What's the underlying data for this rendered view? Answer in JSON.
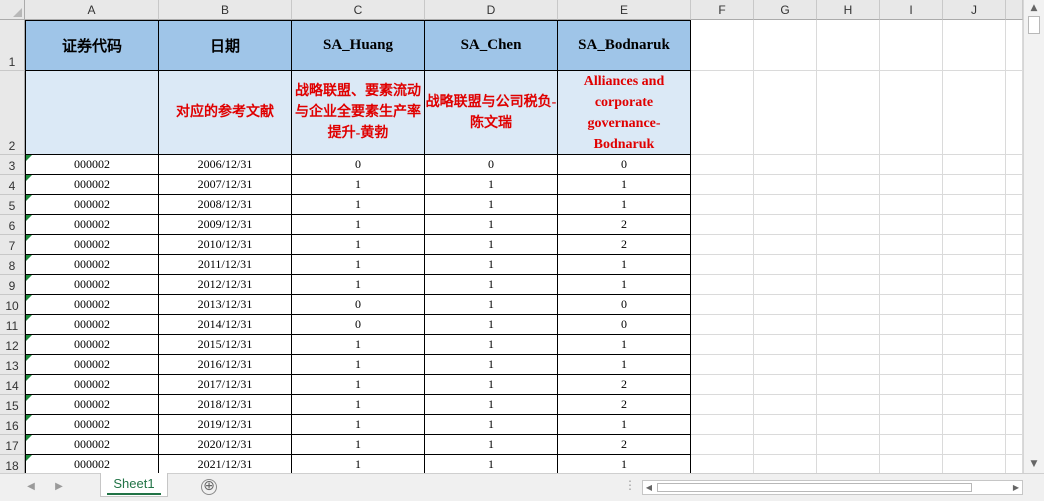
{
  "columns": [
    "A",
    "B",
    "C",
    "D",
    "E",
    "F",
    "G",
    "H",
    "I",
    "J"
  ],
  "header_row": [
    "证券代码",
    "日期",
    "SA_Huang",
    "SA_Chen",
    "SA_Bodnaruk"
  ],
  "reference_row": [
    "",
    "对应的参考文献",
    "战略联盟、要素流动与企业全要素生产率提升-黄勃",
    "战略联盟与公司税负-陈文瑞",
    "Alliances and corporate governance-Bodnaruk"
  ],
  "row_numbers": [
    "1",
    "2",
    "3",
    "4",
    "5",
    "6",
    "7",
    "8",
    "9",
    "10",
    "11",
    "12",
    "13",
    "14",
    "15",
    "16",
    "17",
    "18"
  ],
  "data_rows": [
    [
      "000002",
      "2006/12/31",
      "0",
      "0",
      "0"
    ],
    [
      "000002",
      "2007/12/31",
      "1",
      "1",
      "1"
    ],
    [
      "000002",
      "2008/12/31",
      "1",
      "1",
      "1"
    ],
    [
      "000002",
      "2009/12/31",
      "1",
      "1",
      "2"
    ],
    [
      "000002",
      "2010/12/31",
      "1",
      "1",
      "2"
    ],
    [
      "000002",
      "2011/12/31",
      "1",
      "1",
      "1"
    ],
    [
      "000002",
      "2012/12/31",
      "1",
      "1",
      "1"
    ],
    [
      "000002",
      "2013/12/31",
      "0",
      "1",
      "0"
    ],
    [
      "000002",
      "2014/12/31",
      "0",
      "1",
      "0"
    ],
    [
      "000002",
      "2015/12/31",
      "1",
      "1",
      "1"
    ],
    [
      "000002",
      "2016/12/31",
      "1",
      "1",
      "1"
    ],
    [
      "000002",
      "2017/12/31",
      "1",
      "1",
      "2"
    ],
    [
      "000002",
      "2018/12/31",
      "1",
      "1",
      "2"
    ],
    [
      "000002",
      "2019/12/31",
      "1",
      "1",
      "1"
    ],
    [
      "000002",
      "2020/12/31",
      "1",
      "1",
      "2"
    ],
    [
      "000002",
      "2021/12/31",
      "1",
      "1",
      "1"
    ]
  ],
  "sheet_tab": "Sheet1",
  "add_sheet_symbol": "⊕",
  "colors": {
    "header_fill": "#9fc5e8",
    "reference_fill": "#dbe9f6",
    "reference_text": "#e00000",
    "tab_accent": "#217346"
  }
}
